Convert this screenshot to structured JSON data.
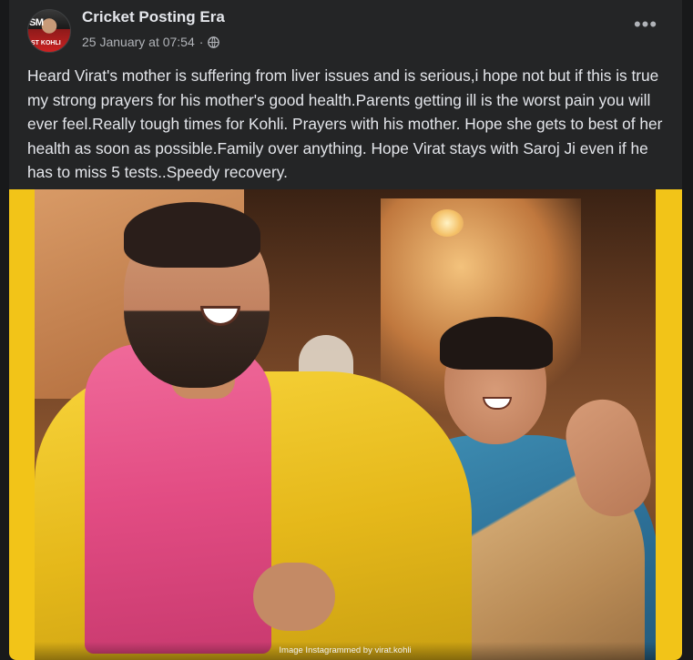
{
  "post": {
    "page_name": "Cricket Posting Era",
    "timestamp": "25 January at 07:54",
    "separator": "·",
    "privacy_icon": "globe-icon",
    "more_label": "•••",
    "avatar_text_top": "SM",
    "avatar_text_bottom": "ST KOHLI",
    "text": "Heard Virat's mother is suffering from liver issues and is serious,i hope not but if this is true my strong prayers for his mother's good health.Parents getting ill is the worst pain you will ever feel.Really tough times for Kohli. Prayers with his mother. Hope she gets to best of her health as soon as possible.Family over anything. Hope Virat stays with Saroj Ji even if he has to miss 5 tests..Speedy recovery.",
    "image": {
      "frame_color": "#f2c418",
      "caption": "Image Instagrammed by virat.kohli"
    }
  },
  "colors": {
    "background": "#18191a",
    "card": "#242526",
    "primary_text": "#e4e6eb",
    "secondary_text": "#b0b3b8"
  }
}
